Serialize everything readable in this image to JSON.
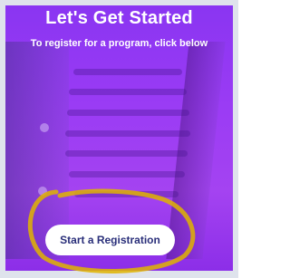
{
  "header": {
    "title": "Let's Get Started",
    "subtitle": "To register for a program, click below"
  },
  "actions": {
    "start_label": "Start a Registration"
  },
  "colors": {
    "card_purple": "#9b3cf4",
    "button_text": "#2a2f7a",
    "highlight_marker": "#e0b400"
  }
}
